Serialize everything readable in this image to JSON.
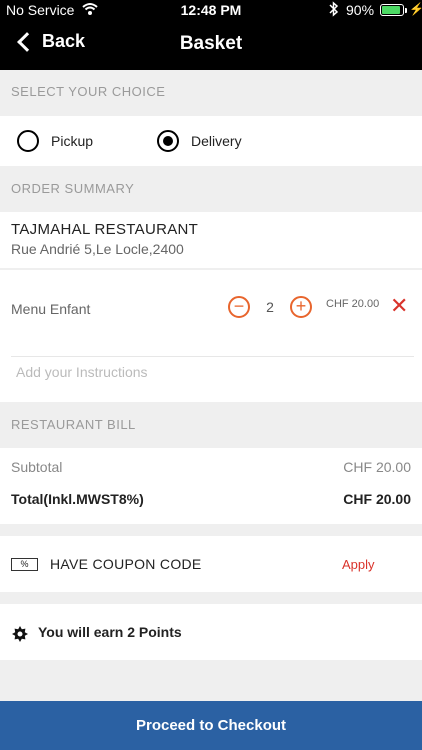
{
  "status_bar": {
    "carrier": "No Service",
    "time": "12:48 PM",
    "battery": "90%",
    "battery_level": 0.9
  },
  "nav": {
    "back_label": "Back",
    "title": "Basket"
  },
  "choice": {
    "header": "SELECT YOUR CHOICE",
    "options": [
      {
        "label": "Pickup",
        "selected": false
      },
      {
        "label": "Delivery",
        "selected": true
      }
    ]
  },
  "order": {
    "header": "ORDER SUMMARY",
    "restaurant_name": "TAJMAHAL RESTAURANT",
    "restaurant_address": "Rue Andrié 5,Le Locle,2400",
    "items": [
      {
        "name": "Menu Enfant",
        "quantity": "2",
        "price": "CHF 20.00"
      }
    ],
    "instructions_placeholder": "Add your Instructions"
  },
  "bill": {
    "header": "RESTAURANT BILL",
    "subtotal_label": "Subtotal",
    "subtotal_value": "CHF 20.00",
    "total_label": "Total(Inkl.MWST8%)",
    "total_value": "CHF 20.00"
  },
  "coupon": {
    "icon_text": "%",
    "label": "HAVE COUPON CODE",
    "apply_label": "Apply"
  },
  "points": {
    "text": "You will earn 2 Points"
  },
  "checkout": {
    "label": "Proceed to Checkout"
  },
  "colors": {
    "accent_orange": "#e8652d",
    "remove_red": "#d9332b",
    "checkout_blue": "#2b61a3",
    "battery_green": "#4cd964"
  }
}
